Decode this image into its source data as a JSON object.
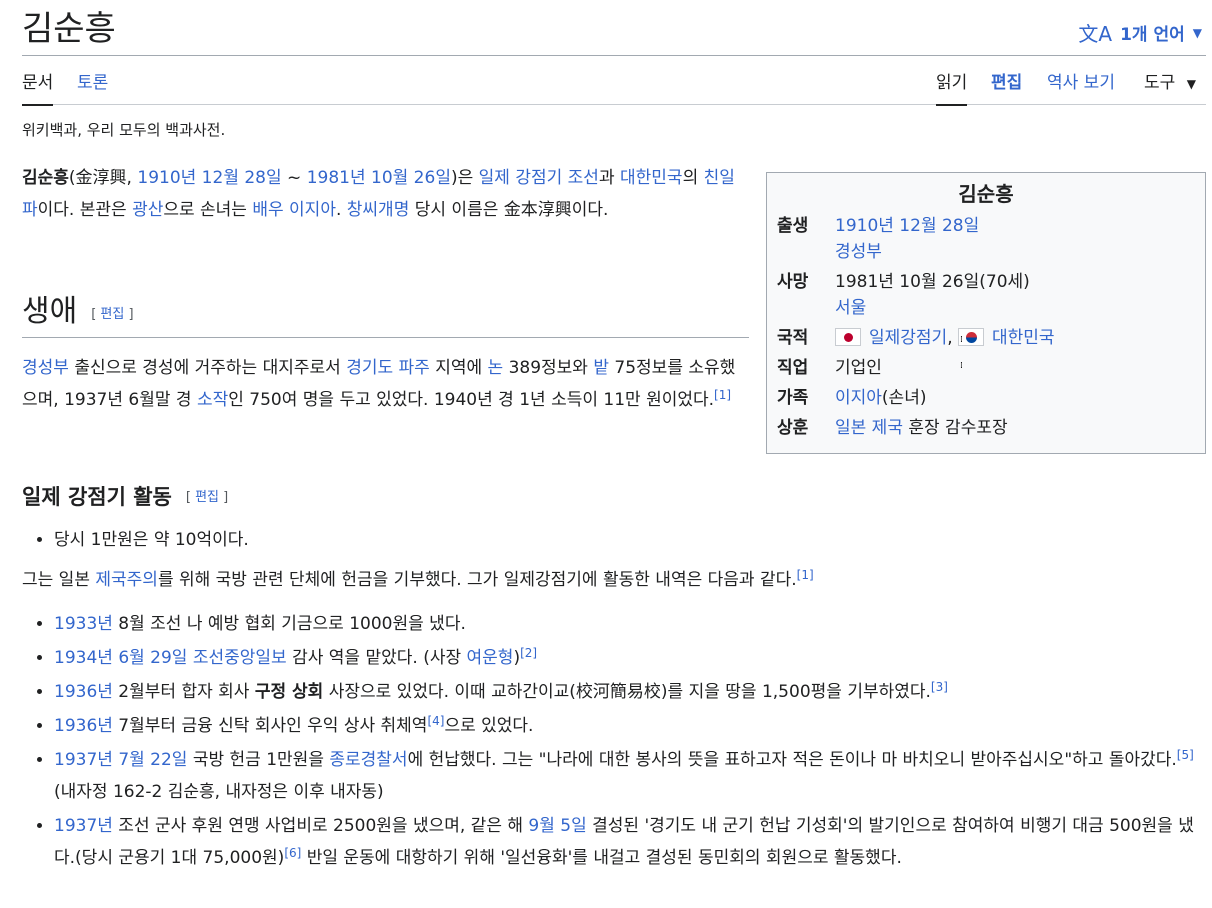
{
  "page": {
    "title": "김순흥",
    "lang_button": "1개 언어",
    "tagline": "위키백과, 우리 모두의 백과사전."
  },
  "tabs": {
    "article": "문서",
    "talk": "토론",
    "read": "읽기",
    "edit": "편집",
    "history": "역사 보기",
    "tools": "도구"
  },
  "lead": {
    "name": "김순흥",
    "hanja": "(金淳興, ",
    "birth": "1910년 12월 28일",
    "tilde": " ~ ",
    "death": "1981년 10월 26일",
    "t1": ")은 ",
    "l_colonial": "일제 강점기 조선",
    "t2": "과 ",
    "l_korea": "대한민국",
    "t3": "의 ",
    "l_collab": "친일파",
    "t4": "이다. 본관은 ",
    "l_gwangsan": "광산",
    "t5": "으로 손녀는 ",
    "l_actress": "배우 이지아",
    "t6": ". ",
    "l_soshi": "창씨개명",
    "t7": " 당시 이름은 金本淳興이다."
  },
  "infobox": {
    "title": "김순흥",
    "birth_label": "출생",
    "birth_date": "1910년 12월 28일",
    "birth_place": "경성부",
    "death_label": "사망",
    "death_date": "1981년 10월 26일(70세)",
    "death_place": "서울",
    "nation_label": "국적",
    "nation_1": "일제강점기",
    "nation_sep": ", ",
    "nation_2": "대한민국",
    "job_label": "직업",
    "job": "기업인",
    "family_label": "가족",
    "family_link": "이지아",
    "family_rel": "(손녀)",
    "award_label": "상훈",
    "award_link": "일본 제국",
    "award_text": " 훈장 감수포장"
  },
  "life": {
    "heading": "생애",
    "edit": "편집",
    "l_gyeongseong": "경성부",
    "t1": " 출신으로 경성에 거주하는 대지주로서 ",
    "l_paju": "경기도 파주",
    "t2": " 지역에 ",
    "l_non": "논",
    "t3": " 389정보와 ",
    "l_bat": "밭",
    "t4": " 75정보를 소유했으며, 1937년 6월말 경 ",
    "l_sojak": "소작",
    "t5": "인 750여 명을 두고 있었다. 1940년 경 1년 소득이 11만 원이었다.",
    "ref1": "[1]"
  },
  "activity": {
    "heading": "일제 강점기 활동",
    "edit": "편집",
    "bullet0": "당시 1만원은 약 10억이다.",
    "intro_t1": "그는 일본 ",
    "intro_link": "제국주의",
    "intro_t2": "를 위해 국방 관련 단체에 헌금을 기부했다. 그가 일제강점기에 활동한 내역은 다음과 같다.",
    "intro_ref": "[1]",
    "i1_year": "1933년",
    "i1_text": " 8월 조선 나 예방 협회 기금으로 1000원을 냈다.",
    "i2_year": "1934년",
    "i2_date": "6월 29일",
    "i2_paper": "조선중앙일보",
    "i2_text": " 감사 역을 맡았다. (사장 ",
    "i2_person": "여운형",
    "i2_close": ")",
    "i2_ref": "[2]",
    "i3_year": "1936년",
    "i3_t1": " 2월부터 합자 회사 ",
    "i3_bold": "구정 상회",
    "i3_t2": " 사장으로 있었다. 이때 교하간이교(校河簡易校)를 지을 땅을 1,500평을 기부하였다.",
    "i3_ref": "[3]",
    "i4_year": "1936년",
    "i4_t1": " 7월부터 금융 신탁 회사인 우익 상사 취체역",
    "i4_ref": "[4]",
    "i4_t2": "으로 있었다.",
    "i5_year": "1937년",
    "i5_date": "7월 22일",
    "i5_t1": " 국방 헌금 1만원을 ",
    "i5_police": "종로경찰서",
    "i5_t2": "에 헌납했다. 그는 \"나라에 대한 봉사의 뜻을 표하고자 적은 돈이나 마 바치오니 받아주십시오\"하고 돌아갔다.",
    "i5_ref": "[5]",
    "i5_t3": " (내자정 162-2 김순흥, 내자정은 이후 내자동)",
    "i6_year": "1937년",
    "i6_t1": " 조선 군사 후원 연맹 사업비로 2500원을 냈으며, 같은 해 ",
    "i6_date": "9월 5일",
    "i6_t2": " 결성된 '경기도 내 군기 헌납 기성회'의 발기인으로 참여하여 비행기 대금 500원을 냈다.(당시 군용기 1대 75,000원)",
    "i6_ref": "[6]",
    "i6_t3": " 반일 운동에 대항하기 위해 '일선융화'를 내걸고 결성된 동민회의 회원으로 활동했다."
  }
}
